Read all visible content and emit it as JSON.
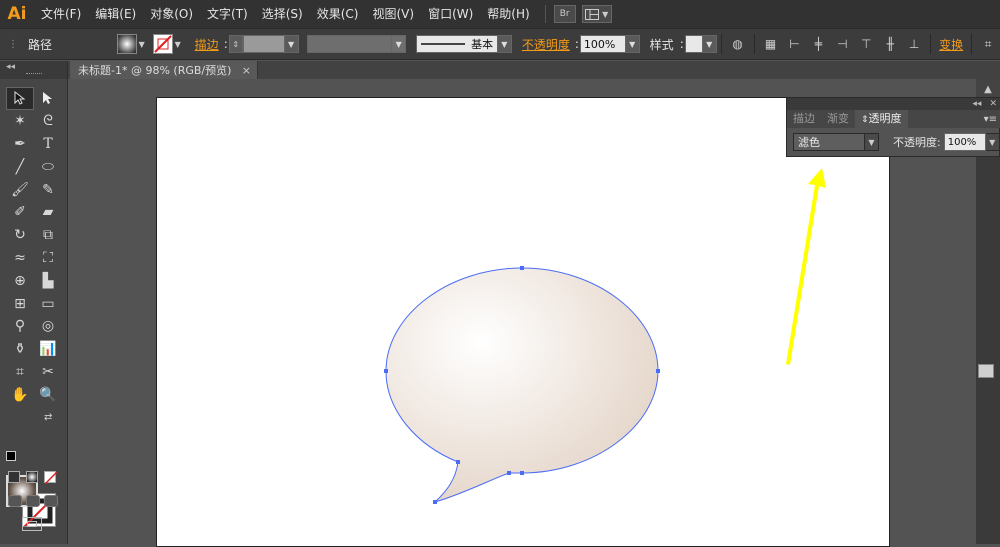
{
  "app": {
    "logo": "Ai"
  },
  "menu": {
    "items": [
      "文件(F)",
      "编辑(E)",
      "对象(O)",
      "文字(T)",
      "选择(S)",
      "效果(C)",
      "视图(V)",
      "窗口(W)",
      "帮助(H)"
    ],
    "bridge_label": "Br",
    "workspace_icon": "grid-layout-icon"
  },
  "control": {
    "object_type": "路径",
    "stroke_label": "描边",
    "stroke_profile": "基本",
    "opacity_label": "不透明度",
    "opacity_value": "100%",
    "style_label": "样式",
    "transform_label": "变换"
  },
  "document": {
    "tab_title": "未标题-1* @ 98% (RGB/预览)",
    "close_glyph": "×"
  },
  "panel": {
    "tabs": [
      "描边",
      "渐变",
      "透明度"
    ],
    "active_tab": "透明度",
    "blend_mode": "滤色",
    "opacity_label": "不透明度:",
    "opacity_value": "100%"
  },
  "colors": {
    "accent": "#f29b1c",
    "selection": "#4a6cf7",
    "arrow": "#ffff00",
    "bubble_center": "#ffffff",
    "bubble_edge": "#e3d3c6"
  }
}
